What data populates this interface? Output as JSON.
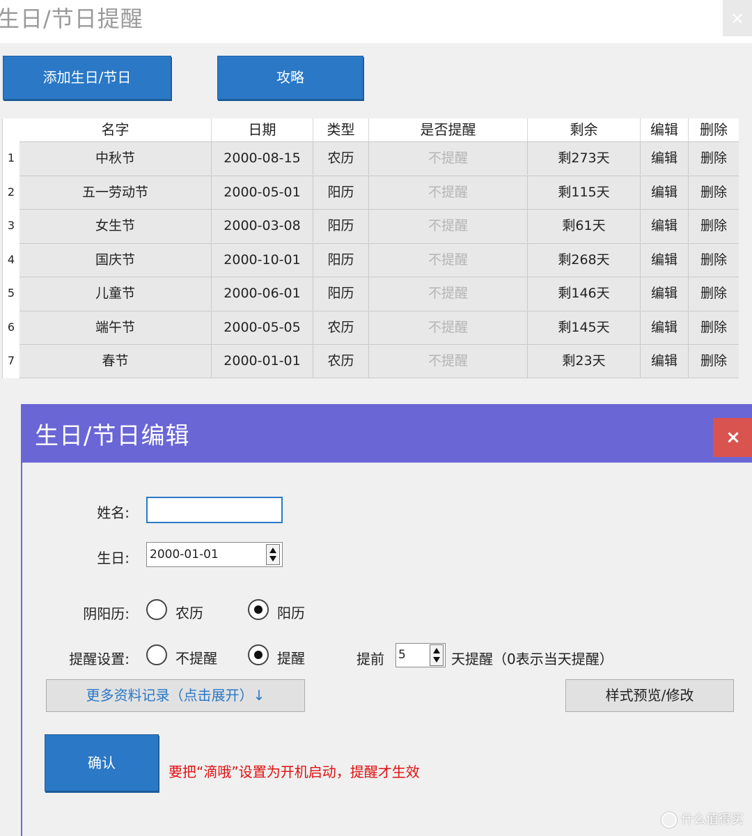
{
  "window": {
    "title": "生日/节日提醒",
    "close_icon": "×"
  },
  "toolbar": {
    "add_label": "添加生日/节日",
    "guide_label": "攻略"
  },
  "table": {
    "headers": [
      "名字",
      "日期",
      "类型",
      "是否提醒",
      "剩余",
      "编辑",
      "删除"
    ],
    "rows": [
      {
        "num": "1",
        "name": "中秋节",
        "date": "2000-08-15",
        "type": "农历",
        "remind": "不提醒",
        "left": "剩273天",
        "edit": "编辑",
        "del": "删除"
      },
      {
        "num": "2",
        "name": "五一劳动节",
        "date": "2000-05-01",
        "type": "阳历",
        "remind": "不提醒",
        "left": "剩115天",
        "edit": "编辑",
        "del": "删除"
      },
      {
        "num": "3",
        "name": "女生节",
        "date": "2000-03-08",
        "type": "阳历",
        "remind": "不提醒",
        "left": "剩61天",
        "edit": "编辑",
        "del": "删除"
      },
      {
        "num": "4",
        "name": "国庆节",
        "date": "2000-10-01",
        "type": "阳历",
        "remind": "不提醒",
        "left": "剩268天",
        "edit": "编辑",
        "del": "删除"
      },
      {
        "num": "5",
        "name": "儿童节",
        "date": "2000-06-01",
        "type": "阳历",
        "remind": "不提醒",
        "left": "剩146天",
        "edit": "编辑",
        "del": "删除"
      },
      {
        "num": "6",
        "name": "端午节",
        "date": "2000-05-05",
        "type": "农历",
        "remind": "不提醒",
        "left": "剩145天",
        "edit": "编辑",
        "del": "删除"
      },
      {
        "num": "7",
        "name": "春节",
        "date": "2000-01-01",
        "type": "农历",
        "remind": "不提醒",
        "left": "剩23天",
        "edit": "编辑",
        "del": "删除"
      }
    ]
  },
  "dialog": {
    "title": "生日/节日编辑",
    "close_icon": "×",
    "name_label": "姓名:",
    "name_value": "",
    "birthday_label": "生日:",
    "birthday_value": "2000-01-01",
    "calendar_label": "阴阳历:",
    "calendar_options": [
      "农历",
      "阳历"
    ],
    "calendar_selected": "阳历",
    "remind_label": "提醒设置:",
    "remind_options": [
      "不提醒",
      "提醒"
    ],
    "remind_selected": "提醒",
    "advance_label": "提前",
    "advance_value": "5",
    "advance_suffix": "天提醒（0表示当天提醒）",
    "more_label": "更多资料记录（点击展开）↓",
    "style_label": "样式预览/修改",
    "confirm_label": "确认",
    "warning": "要把“滴哦”设置为开机启动，提醒才生效"
  },
  "watermark": "什么值得买",
  "colors": {
    "accent_blue": "#2a78c6",
    "dialog_purple": "#6a66d6",
    "close_red": "#d9534f",
    "warning_red": "#e01010"
  }
}
